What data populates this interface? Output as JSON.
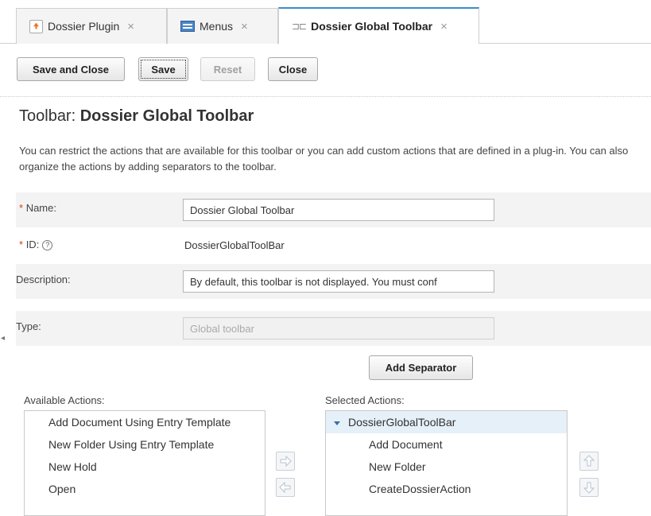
{
  "tabs": [
    {
      "label": "Dossier Plugin",
      "close": "×",
      "icon": "plugin-icon"
    },
    {
      "label": "Menus",
      "close": "×",
      "icon": "menus-icon"
    },
    {
      "label": "Dossier Global Toolbar",
      "close": "×",
      "icon": "toolbar-icon",
      "active": true
    }
  ],
  "toolbar_icon_glyph": "⊐⊏",
  "buttons": {
    "save_and_close": "Save and Close",
    "save": "Save",
    "reset": "Reset",
    "close": "Close"
  },
  "page": {
    "title_prefix": "Toolbar:",
    "title_name": "Dossier Global Toolbar",
    "description": "You can restrict the actions that are available for this toolbar or you can add custom actions that are defined in a plug-in. You can also organize the actions by adding separators to the toolbar."
  },
  "form": {
    "required_mark": "*",
    "name_label": "Name:",
    "name_value": "Dossier Global Toolbar",
    "id_label": "ID:",
    "id_help": "?",
    "id_value": "DossierGlobalToolBar",
    "description_label": "Description:",
    "description_value": "By default, this toolbar is not displayed. You must conf",
    "type_label": "Type:",
    "type_value": "Global toolbar"
  },
  "add_separator_label": "Add Separator",
  "available_actions": {
    "label": "Available Actions:",
    "items": [
      "Add Document Using Entry Template",
      "New Folder Using Entry Template",
      "New Hold",
      "Open"
    ]
  },
  "selected_actions": {
    "label": "Selected Actions:",
    "root": "DossierGlobalToolBar",
    "children": [
      "Add Document",
      "New Folder",
      "CreateDossierAction"
    ]
  },
  "colors": {
    "accent": "#3c8ec7",
    "required": "#d0421b",
    "selected_row": "#e6f0f8"
  }
}
